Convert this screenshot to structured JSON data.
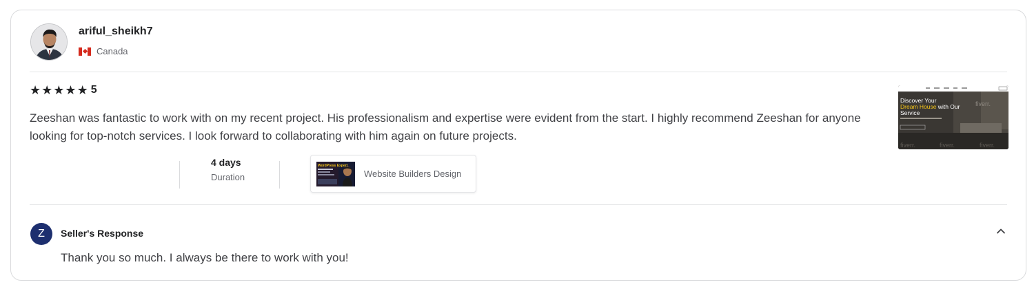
{
  "review": {
    "username": "ariful_sheikh7",
    "country": "Canada",
    "country_flag_icon": "canada-flag-icon",
    "rating_value": "5",
    "stars": 5,
    "text": "Zeeshan was fantastic to work with on my recent project. His professionalism and expertise were evident from the start. I highly recommend Zeeshan for anyone looking for top-notch services. I look forward to collaborating with him again on future projects.",
    "duration_value": "4 days",
    "duration_label": "Duration",
    "gig_title": "Website Builders Design",
    "gig_thumb_text": "WordPress Expert",
    "work_sample": {
      "headline_1": "Discover Your",
      "headline_2": "Dream House",
      "headline_3": " with Our",
      "headline_4": "Service",
      "watermark": "fiverr."
    }
  },
  "seller_response": {
    "avatar_letter": "Z",
    "title": "Seller's Response",
    "text": "Thank you so much. I always be there to work with you!",
    "toggle_icon": "chevron-up-icon"
  },
  "colors": {
    "text_dark": "#222325",
    "text_body": "#404145",
    "text_muted": "#62646a",
    "border": "#dadbdd",
    "seller_avatar_bg": "#1d2f6f"
  }
}
